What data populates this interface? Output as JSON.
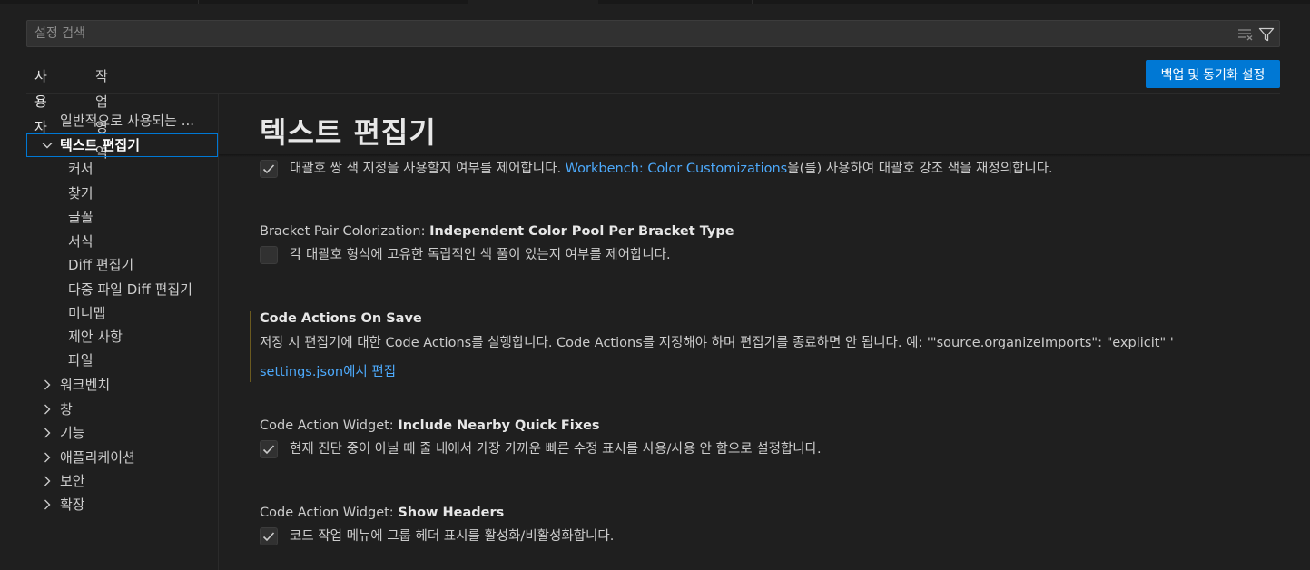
{
  "search": {
    "placeholder": "설정 검색"
  },
  "tabs": [
    {
      "label": "사용자"
    },
    {
      "label": "작업 영역"
    }
  ],
  "backup_button": {
    "label": "백업 및 동기화 설정"
  },
  "tree": {
    "items": [
      {
        "label": "일반적으로 사용되는 ..."
      },
      {
        "label": "텍스트 편집기"
      },
      {
        "label": "커서"
      },
      {
        "label": "찾기"
      },
      {
        "label": "글꼴"
      },
      {
        "label": "서식"
      },
      {
        "label": "Diff 편집기"
      },
      {
        "label": "다중 파일 Diff 편집기"
      },
      {
        "label": "미니맵"
      },
      {
        "label": "제안 사항"
      },
      {
        "label": "파일"
      },
      {
        "label": "워크벤치"
      },
      {
        "label": "창"
      },
      {
        "label": "기능"
      },
      {
        "label": "애플리케이션"
      },
      {
        "label": "보안"
      },
      {
        "label": "확장"
      }
    ]
  },
  "content": {
    "title": "텍스트 편집기",
    "settings": [
      {
        "desc_before": "대괄호 쌍 색 지정을 사용할지 여부를 제어합니다. ",
        "link": "Workbench: Color Customizations",
        "desc_after": "을(를) 사용하여 대괄호 강조 색을 재정의합니다.",
        "checked": true
      },
      {
        "category": "Bracket Pair Colorization: ",
        "key": "Independent Color Pool Per Bracket Type",
        "desc": "각 대괄호 형식에 고유한 독립적인 색 풀이 있는지 여부를 제어합니다.",
        "checked": false
      },
      {
        "key": "Code Actions On Save",
        "desc": "저장 시 편집기에 대한 Code Actions를 실행합니다. Code Actions를 지정해야 하며 편집기를 종료하면 안 됩니다. 예: '\"source.organizeImports\": \"explicit\" '",
        "link": "settings.json에서 편집"
      },
      {
        "category": "Code Action Widget: ",
        "key": "Include Nearby Quick Fixes",
        "desc": "현재 진단 중이 아닐 때 줄 내에서 가장 가까운 빠른 수정 표시를 사용/사용 안 함으로 설정합니다.",
        "checked": true
      },
      {
        "category": "Code Action Widget: ",
        "key": "Show Headers",
        "desc": "코드 작업 메뉴에 그룹 헤더 표시를 활성화/비활성화합니다.",
        "checked": true
      }
    ]
  }
}
